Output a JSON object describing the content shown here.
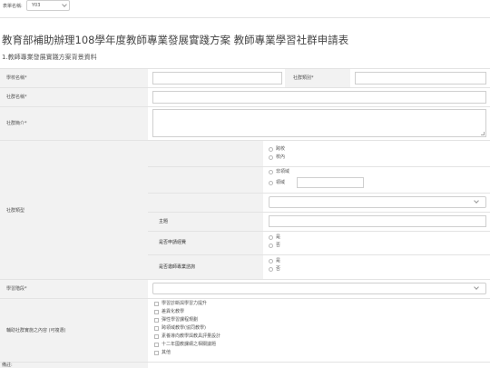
{
  "top_bar": {
    "form_name_label": "表單名稱:",
    "form_name_value": "Y03"
  },
  "page": {
    "title": "教育部補助辦理108學年度教師專業發展實踐方案 教師專業學習社群申請表",
    "section_title": "1.教師專業發展實踐方案背景資料"
  },
  "fields": {
    "school_name_label": "學校名稱*",
    "community_category_label": "社群類別*",
    "community_name_label": "社群名稱*",
    "community_intro_label": "社群簡介*",
    "community_type_label": "社群類型",
    "type_options": {
      "school_scope": [
        "跨校",
        "校內"
      ],
      "domain_scope": [
        "非領域",
        "領域"
      ]
    },
    "subject_label": "主題",
    "funding_label": "是否申請經費",
    "funding_options": [
      "是",
      "否"
    ],
    "mentor_label": "是否邀師專業諮詢",
    "mentor_options": [
      "是",
      "否"
    ],
    "stage_label": "學習階段*",
    "content_label": "輔助社群實施之內容 (可複選)",
    "content_options": [
      "學習診斷與學習力提升",
      "差異化教學",
      "彈性學習課程規劃",
      "跨領域教學(協同教學)",
      "素養導向教學與教具評量設計",
      "十二年國教課綱之相關議題",
      "其他"
    ]
  },
  "footer": {
    "note_label": "備註:"
  },
  "colors": {
    "label_bg": "#f2f2f2",
    "border": "#cfcfcf",
    "text": "#444444"
  }
}
